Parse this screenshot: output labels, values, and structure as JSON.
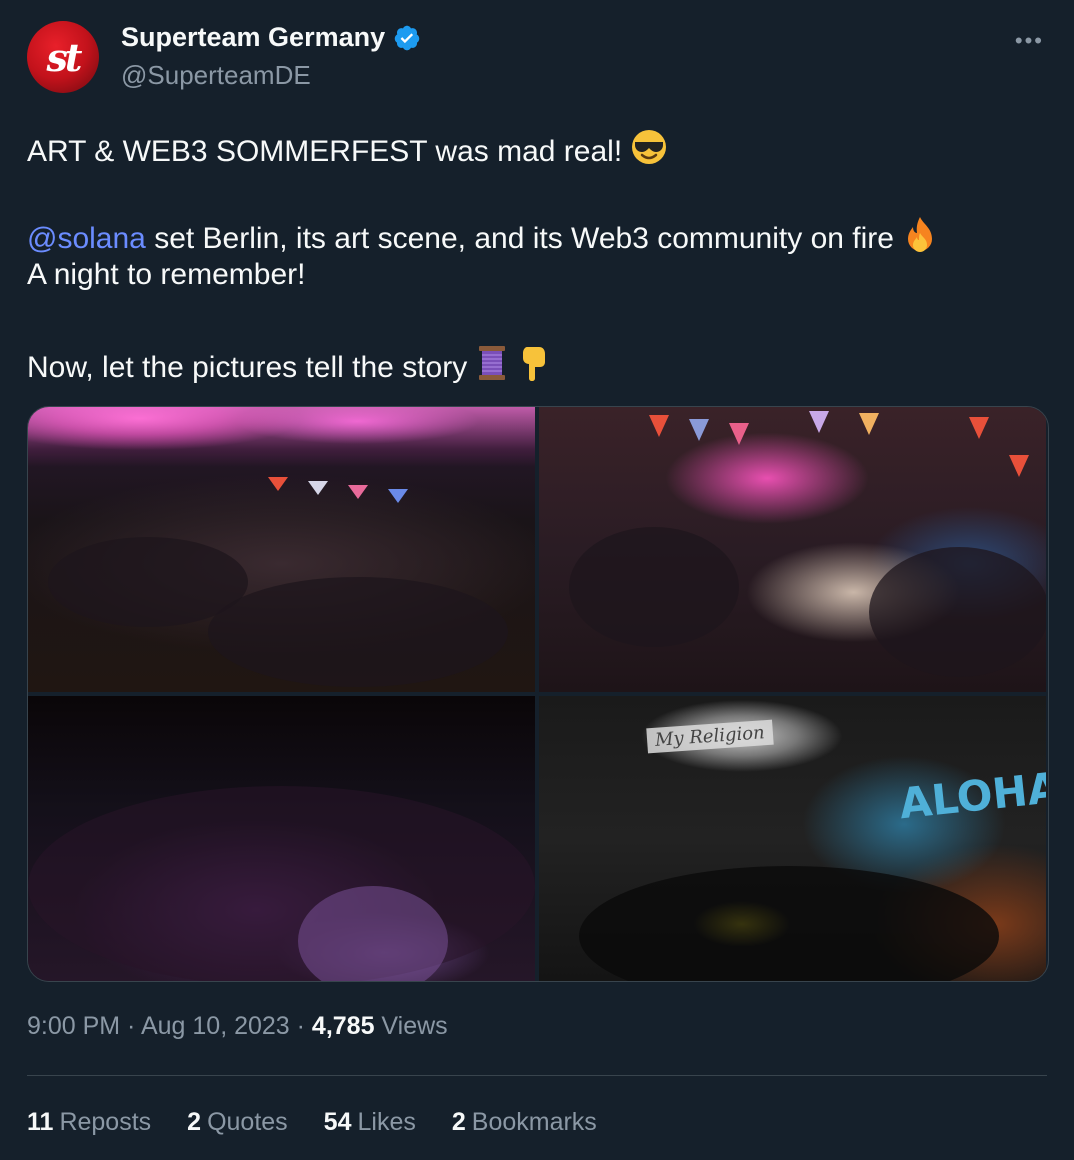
{
  "author": {
    "display_name": "Superteam Germany",
    "handle": "@SuperteamDE",
    "avatar_text": "st",
    "verified": true
  },
  "tweet": {
    "line1": "ART & WEB3 SOMMERFEST was mad real!",
    "line2_mention": "@solana",
    "line2_rest": " set Berlin, its art scene, and its Web3 community on fire",
    "line3": "A night to remember!",
    "line4": "Now, let the pictures tell the story",
    "emojis": [
      "smiling-face-with-sunglasses",
      "fire",
      "thread",
      "backhand-index-pointing-down"
    ]
  },
  "media": {
    "photo4_sign": "My Religion",
    "photo4_graffiti": "ALOHA"
  },
  "meta": {
    "time": "9:00 PM",
    "sep1": " · ",
    "date": "Aug 10, 2023",
    "sep2": " · ",
    "views_count": "4,785",
    "views_label": " Views"
  },
  "stats": {
    "reposts_count": "11",
    "reposts_label": "Reposts",
    "quotes_count": "2",
    "quotes_label": "Quotes",
    "likes_count": "54",
    "likes_label": "Likes",
    "bookmarks_count": "2",
    "bookmarks_label": "Bookmarks"
  },
  "colors": {
    "background": "#15202b",
    "mention": "#6b8cff",
    "secondary_text": "#8b98a5",
    "verified_badge": "#1d9bf0"
  }
}
